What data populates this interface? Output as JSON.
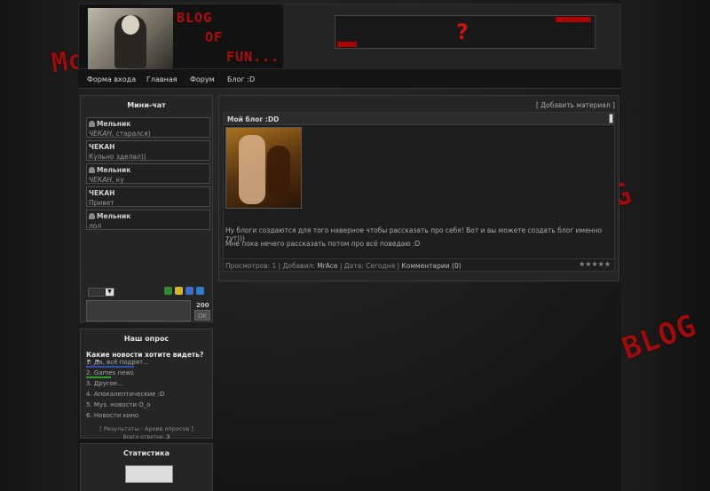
{
  "header": {
    "logo_lines": [
      "BLOG",
      "OF",
      "FUN..."
    ],
    "banner_text": "?"
  },
  "nav": {
    "items": [
      "Форма входа",
      "Главная",
      "Форум",
      "Блог :D"
    ]
  },
  "decorations": {
    "left_text": "Mo",
    "right_text_1": "G",
    "right_text_2": "BLOG"
  },
  "chat": {
    "title": "Мини-чат",
    "messages": [
      {
        "author": "Мельник",
        "mention": "ЧЕКАН",
        "text": ", старался)"
      },
      {
        "author": "ЧЕКАН",
        "mention": "",
        "text": "Кульно зделал))"
      },
      {
        "author": "Мельник",
        "mention": "ЧЕКАН",
        "text": ", ку"
      },
      {
        "author": "ЧЕКАН",
        "mention": "",
        "text": "Привет"
      },
      {
        "author": "Мельник",
        "mention": "",
        "text": "лол"
      }
    ],
    "counter": "200",
    "ok_label": "OK"
  },
  "poll": {
    "title": "Наш опрос",
    "question": "Какие новости хотите видеть? ^_^",
    "options": [
      "1. Да, всё подрят...",
      "2. Games news",
      "3. Другое...",
      "4. Апокалептические :D",
      "5. Муз. новости О_о",
      "6. Новости кино"
    ],
    "links": "[ Результаты · Архив опросов ]",
    "total_label": "Всего ответов:",
    "total_value": "3",
    "colors": {
      "bar1": "#2f4fb3",
      "bar2": "#2aa02a"
    }
  },
  "stats": {
    "title": "Статистика"
  },
  "content": {
    "add_link": "[ Добавить материал ]",
    "post": {
      "title": "Мой блог :DD",
      "text_1": "Ну блоги создаются для того наверное чтобы рассказать про себя! Вот и вы можете создать блог именно тут)))",
      "text_2": "Мне пока нечего рассказать потом про всё поведаю :D",
      "meta": {
        "views_label": "Просмотров:",
        "views": "1",
        "added_label": "Добавил:",
        "author": "MrAce",
        "date_label": "Дата:",
        "date": "Сегодня",
        "comments": "Комментарии (0)"
      },
      "stars": "★★★★★"
    }
  }
}
